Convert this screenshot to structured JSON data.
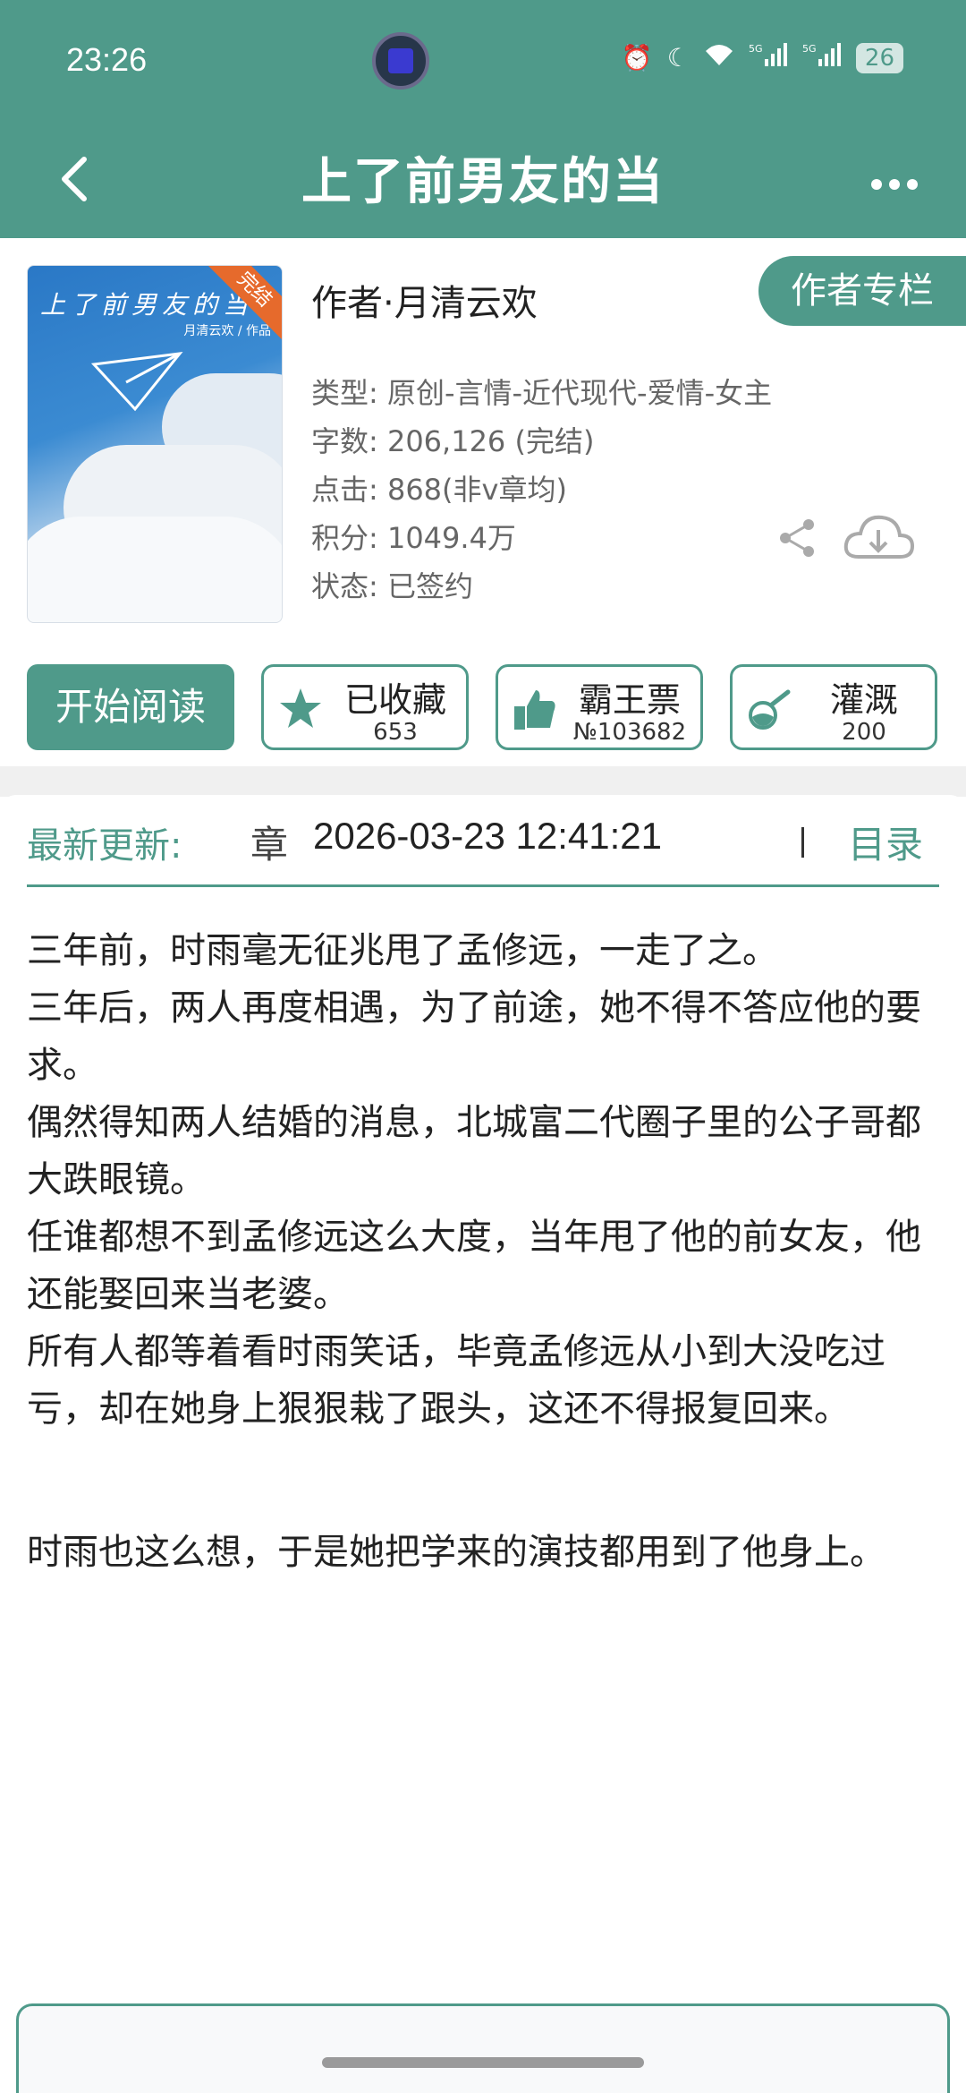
{
  "status_bar": {
    "time": "23:26",
    "battery": "26",
    "icons": [
      "alarm-icon",
      "moon-icon",
      "wifi-icon",
      "5g-signal-icon",
      "5g-signal-icon"
    ]
  },
  "header": {
    "title": "上了前男友的当"
  },
  "book": {
    "cover_title": "上了前男友的当",
    "cover_author": "月清云欢 / 作品",
    "cover_ribbon": "完结",
    "author": "作者·月清云欢",
    "author_column_label": "作者专栏",
    "meta": [
      "类型: 原创-言情-近代现代-爱情-女主",
      "字数: 206,126 (完结)",
      "点击: 868(非v章均)",
      "积分: 1049.4万",
      "状态: 已签约"
    ]
  },
  "actions": {
    "read_label": "开始阅读",
    "favorite": {
      "label": "已收藏",
      "count": "653"
    },
    "ticket": {
      "label": "霸王票",
      "count": "№103682"
    },
    "nutrient": {
      "label": "灌溉",
      "count": "200"
    }
  },
  "latest_update": {
    "label": "最新更新:",
    "chapter": "章",
    "datetime": "2026-03-23 12:41:21",
    "toc_label": "目录"
  },
  "synopsis": [
    "三年前，时雨毫无征兆甩了孟修远，一走了之。",
    "三年后，两人再度相遇，为了前途，她不得不答应他的要求。",
    "偶然得知两人结婚的消息，北城富二代圈子里的公子哥都大跌眼镜。",
    "任谁都想不到孟修远这么大度，当年甩了他的前女友，他还能娶回来当老婆。",
    "所有人都等着看时雨笑话，毕竟孟修远从小到大没吃过亏，却在她身上狠狠栽了跟头，这还不得报复回来。",
    "",
    "时雨也这么想，于是她把学来的演技都用到了他身上。"
  ],
  "colors": {
    "accent": "#4f9a8a",
    "ribbon": "#e66a2c"
  }
}
